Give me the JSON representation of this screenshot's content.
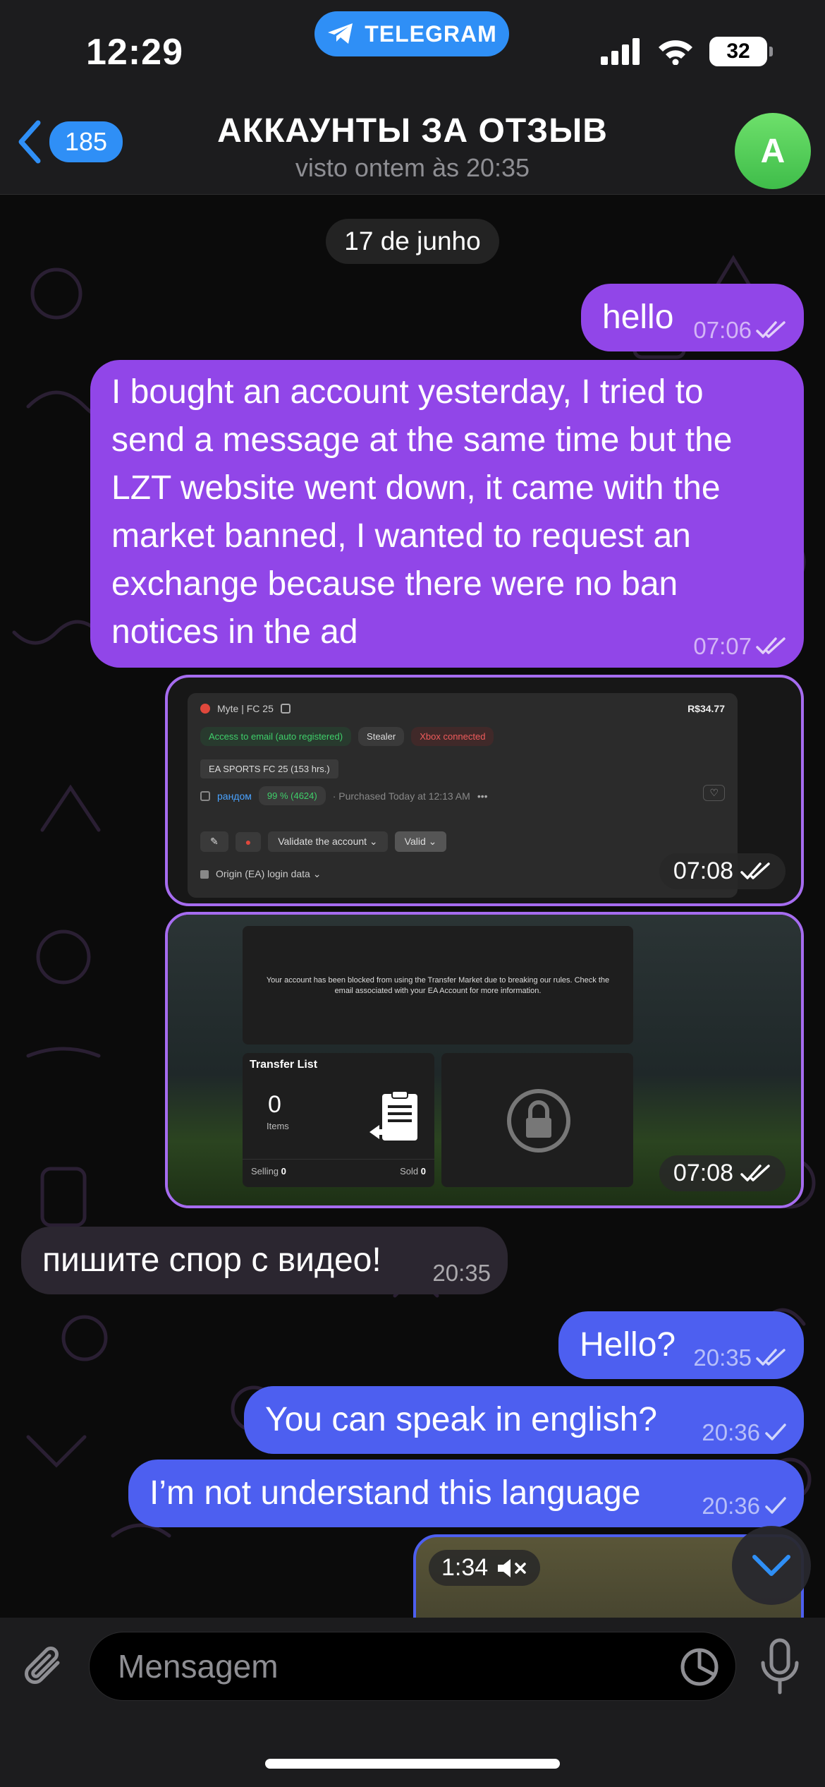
{
  "status_bar": {
    "time": "12:29",
    "app_pill": "TELEGRAM",
    "battery": "32"
  },
  "header": {
    "back_count": "185",
    "title": "АККАУНТЫ ЗА ОТЗЫВ",
    "subtitle": "visto ontem às 20:35",
    "avatar_letter": "A"
  },
  "date_chip": "17 de junho",
  "messages": [
    {
      "type": "text",
      "direction": "out",
      "text": "hello",
      "time": "07:06",
      "status": "read"
    },
    {
      "type": "text",
      "direction": "out",
      "lines": [
        "I bought an account yesterday, I tried to",
        "send a message at the same time but the",
        "LZT website went down, it came with the",
        "market banned, I wanted to request an",
        "exchange because there were no ban",
        "notices in the ad"
      ],
      "time": "07:07",
      "status": "read"
    },
    {
      "type": "image",
      "direction": "out",
      "time": "07:08",
      "status": "read",
      "content": {
        "title": "Myte | FC 25",
        "price": "R$34.77",
        "chips": [
          "Access to email (auto registered)",
          "Stealer",
          "Xbox connected"
        ],
        "game": "EA SPORTS FC 25 (153 hrs.)",
        "seller": "рандом",
        "rating": "99 % (4624)",
        "purchased": "· Purchased Today at 12:13 AM",
        "validate": "Validate the account",
        "valid": "Valid",
        "login": "Origin (EA) login data"
      }
    },
    {
      "type": "image",
      "direction": "out",
      "time": "07:08",
      "status": "read",
      "content": {
        "notice": "Your account has been blocked from using the Transfer Market due to breaking our rules. Check the email associated with your EA Account for more information.",
        "transfer_title": "Transfer List",
        "items_count": "0",
        "items_label": "Items",
        "selling_label": "Selling",
        "selling_value": "0",
        "sold_label": "Sold",
        "sold_value": "0"
      }
    },
    {
      "type": "text",
      "direction": "in",
      "text": "пишите спор с видео!",
      "time": "20:35"
    },
    {
      "type": "text",
      "direction": "out",
      "text": "Hello?",
      "time": "20:35",
      "status": "read"
    },
    {
      "type": "text",
      "direction": "out",
      "text": "You can speak in english?",
      "time": "20:36",
      "status": "sent"
    },
    {
      "type": "text",
      "direction": "out",
      "text": "I’m not understand this language",
      "time": "20:36",
      "status": "sent"
    },
    {
      "type": "video",
      "direction": "out",
      "duration": "1:34"
    }
  ],
  "input": {
    "placeholder": "Mensagem"
  },
  "colors": {
    "out_bubble_purple": "#9146e8",
    "out_bubble_blue": "#4d5ff0",
    "in_bubble": "#2b2630",
    "accent": "#2f8ff6",
    "avatar": "#4cc955"
  }
}
